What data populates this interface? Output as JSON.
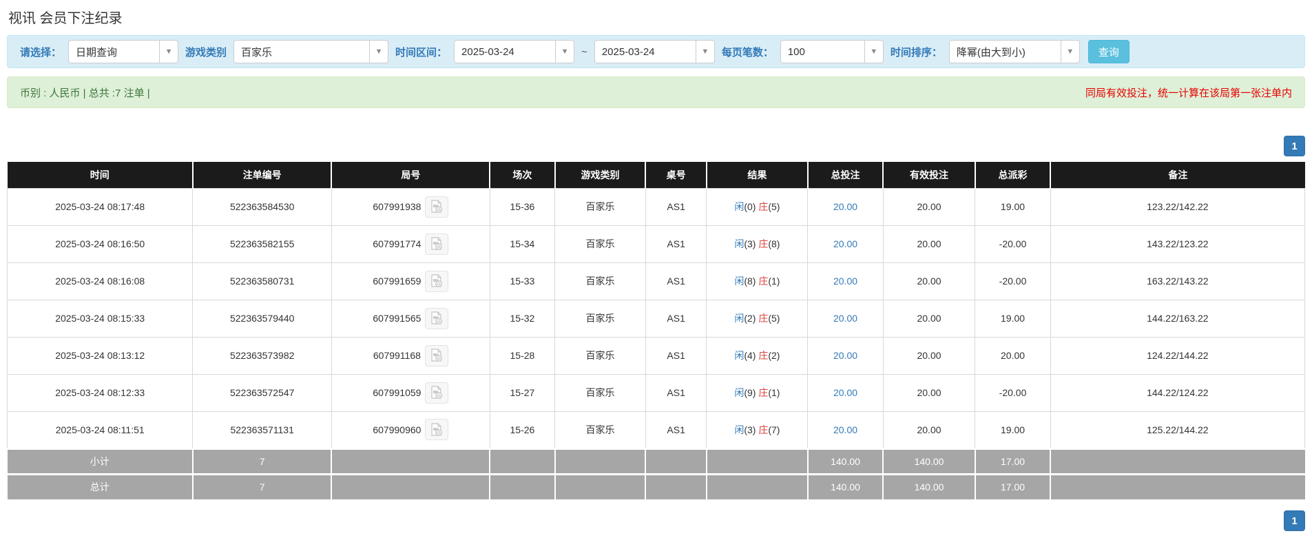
{
  "page": {
    "title": "视讯 会员下注纪录"
  },
  "colors": {
    "accent_blue": "#337ab7",
    "query_button_bg": "#5bc0de",
    "filter_bar_bg": "#d9edf7",
    "summary_bar_bg": "#dff0d8",
    "summary_text_green": "#3c763d",
    "warning_red": "#e60000",
    "table_header_bg": "#1b1b1b",
    "table_footer_bg": "#a6a6a6",
    "result_player_blue": "#337ab7",
    "result_banker_red": "#d9433f"
  },
  "filters": {
    "select_label": "请选择：",
    "select_value": "日期查询",
    "game_label": "游戏类别",
    "game_value": "百家乐",
    "range_label": "时间区间：",
    "date_from": "2025-03-24",
    "tilde": "~",
    "date_to": "2025-03-24",
    "per_page_label": "每页笔数：",
    "per_page_value": "100",
    "sort_label": "时间排序：",
    "sort_value": "降幂(由大到小)",
    "query_button": "查询",
    "caret": "▼"
  },
  "summary": {
    "left": "币别 : 人民币 | 总共 :7 注单 |",
    "right": "同局有效投注，统一计算在该局第一张注单内"
  },
  "pagination": {
    "page": "1"
  },
  "table": {
    "headers": [
      "时间",
      "注单编号",
      "局号",
      "场次",
      "游戏类别",
      "桌号",
      "结果",
      "总投注",
      "有效投注",
      "总派彩",
      "备注"
    ],
    "rows": [
      {
        "time": "2025-03-24 08:17:48",
        "bet_id": "522363584530",
        "round": "607991938",
        "session": "15-36",
        "game": "百家乐",
        "table": "AS1",
        "result_player": "闲",
        "result_player_n": "(0)",
        "result_banker": "庄",
        "result_banker_n": "(5)",
        "total_bet": "20.00",
        "valid_bet": "20.00",
        "payout": "19.00",
        "remark": "123.22/142.22"
      },
      {
        "time": "2025-03-24 08:16:50",
        "bet_id": "522363582155",
        "round": "607991774",
        "session": "15-34",
        "game": "百家乐",
        "table": "AS1",
        "result_player": "闲",
        "result_player_n": "(3)",
        "result_banker": "庄",
        "result_banker_n": "(8)",
        "total_bet": "20.00",
        "valid_bet": "20.00",
        "payout": "-20.00",
        "remark": "143.22/123.22"
      },
      {
        "time": "2025-03-24 08:16:08",
        "bet_id": "522363580731",
        "round": "607991659",
        "session": "15-33",
        "game": "百家乐",
        "table": "AS1",
        "result_player": "闲",
        "result_player_n": "(8)",
        "result_banker": "庄",
        "result_banker_n": "(1)",
        "total_bet": "20.00",
        "valid_bet": "20.00",
        "payout": "-20.00",
        "remark": "163.22/143.22"
      },
      {
        "time": "2025-03-24 08:15:33",
        "bet_id": "522363579440",
        "round": "607991565",
        "session": "15-32",
        "game": "百家乐",
        "table": "AS1",
        "result_player": "闲",
        "result_player_n": "(2)",
        "result_banker": "庄",
        "result_banker_n": "(5)",
        "total_bet": "20.00",
        "valid_bet": "20.00",
        "payout": "19.00",
        "remark": "144.22/163.22"
      },
      {
        "time": "2025-03-24 08:13:12",
        "bet_id": "522363573982",
        "round": "607991168",
        "session": "15-28",
        "game": "百家乐",
        "table": "AS1",
        "result_player": "闲",
        "result_player_n": "(4)",
        "result_banker": "庄",
        "result_banker_n": "(2)",
        "total_bet": "20.00",
        "valid_bet": "20.00",
        "payout": "20.00",
        "remark": "124.22/144.22"
      },
      {
        "time": "2025-03-24 08:12:33",
        "bet_id": "522363572547",
        "round": "607991059",
        "session": "15-27",
        "game": "百家乐",
        "table": "AS1",
        "result_player": "闲",
        "result_player_n": "(9)",
        "result_banker": "庄",
        "result_banker_n": "(1)",
        "total_bet": "20.00",
        "valid_bet": "20.00",
        "payout": "-20.00",
        "remark": "144.22/124.22"
      },
      {
        "time": "2025-03-24 08:11:51",
        "bet_id": "522363571131",
        "round": "607990960",
        "session": "15-26",
        "game": "百家乐",
        "table": "AS1",
        "result_player": "闲",
        "result_player_n": "(3)",
        "result_banker": "庄",
        "result_banker_n": "(7)",
        "total_bet": "20.00",
        "valid_bet": "20.00",
        "payout": "19.00",
        "remark": "125.22/144.22"
      }
    ],
    "subtotal": {
      "label": "小计",
      "count": "7",
      "total_bet": "140.00",
      "valid_bet": "140.00",
      "payout": "17.00"
    },
    "total": {
      "label": "总计",
      "count": "7",
      "total_bet": "140.00",
      "valid_bet": "140.00",
      "payout": "17.00"
    }
  }
}
